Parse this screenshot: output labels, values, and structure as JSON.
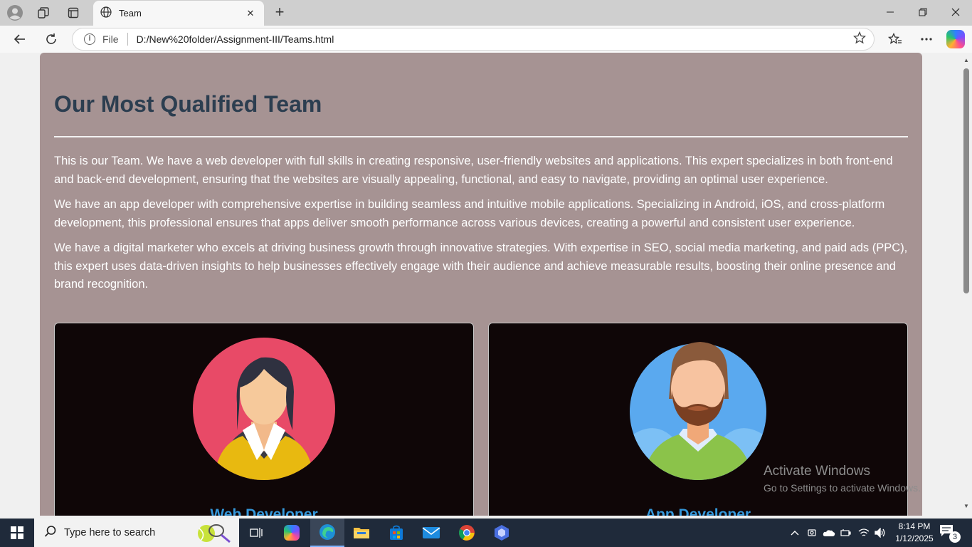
{
  "browser": {
    "tab_title": "Team",
    "tab_close": "✕",
    "new_tab": "+",
    "address_file_label": "File",
    "url": "D:/New%20folder/Assignment-III/Teams.html"
  },
  "page": {
    "title": "Our Most Qualified Team",
    "paragraphs": [
      "This is our Team. We have a web developer with full skills in creating responsive, user-friendly websites and applications. This expert specializes in both front-end and back-end development, ensuring that the websites are visually appealing, functional, and easy to navigate, providing an optimal user experience.",
      "We have an app developer with comprehensive expertise in building seamless and intuitive mobile applications. Specializing in Android, iOS, and cross-platform development, this professional ensures that apps deliver smooth performance across various devices, creating a powerful and consistent user experience.",
      "We have a digital marketer who excels at driving business growth through innovative strategies. With expertise in SEO, social media marketing, and paid ads (PPC), this expert uses data-driven insights to help businesses effectively engage with their audience and achieve measurable results, boosting their online presence and brand recognition."
    ],
    "cards": [
      {
        "title": "Web Developer",
        "avatar": "female-avatar"
      },
      {
        "title": "App Developer",
        "avatar": "male-bearded-avatar"
      }
    ]
  },
  "watermark": {
    "line1": "Activate Windows",
    "line2": "Go to Settings to activate Windows."
  },
  "taskbar": {
    "search_placeholder": "Type here to search",
    "time": "8:14 PM",
    "date": "1/12/2025",
    "notification_count": "3"
  },
  "colors": {
    "page_background": "#a69393",
    "title": "#2c3e50",
    "card_background": "#0f0607",
    "card_title": "#3498db"
  }
}
